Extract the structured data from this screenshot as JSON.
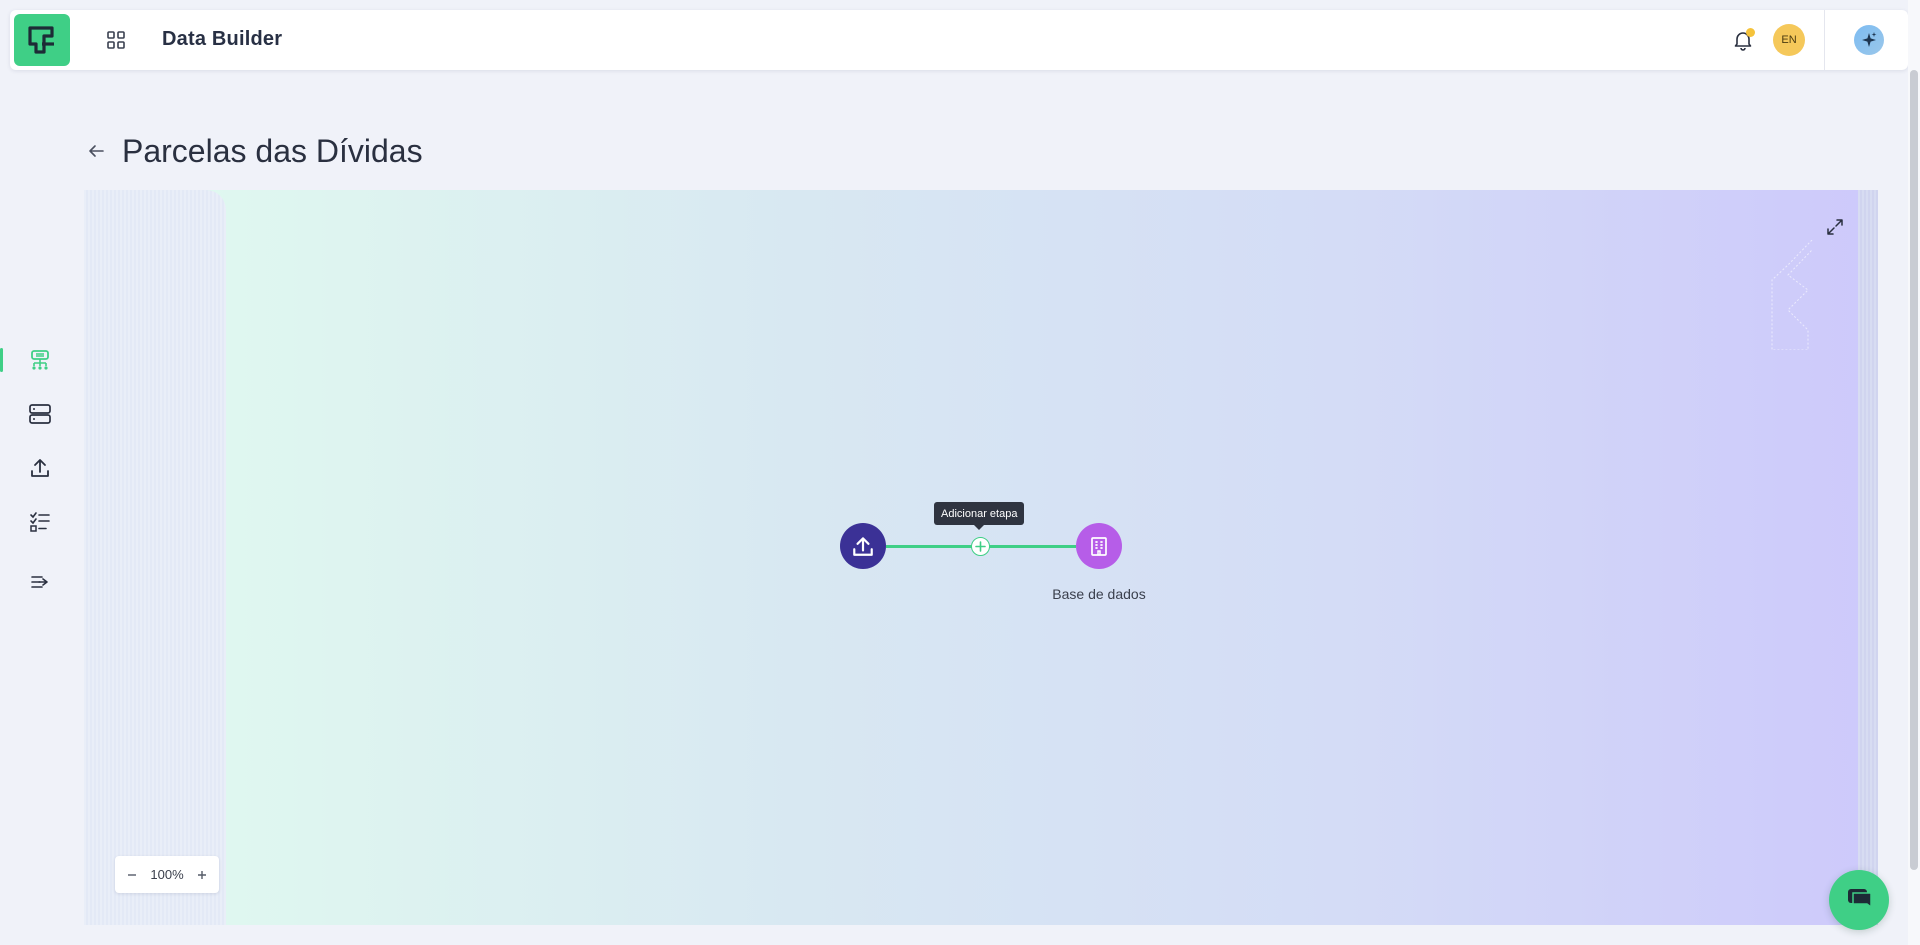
{
  "header": {
    "app_title": "Data Builder",
    "language": "EN",
    "icons": [
      "logo-icon",
      "apps-grid-icon",
      "bell-icon",
      "sparkle-icon"
    ]
  },
  "sidebar": {
    "items": [
      {
        "name": "pipeline",
        "icon": "pipeline-icon",
        "active": true
      },
      {
        "name": "databases",
        "icon": "server-icon",
        "active": false
      },
      {
        "name": "upload",
        "icon": "upload-icon",
        "active": false
      },
      {
        "name": "checklist",
        "icon": "checklist-icon",
        "active": false
      },
      {
        "name": "export",
        "icon": "export-list-icon",
        "active": false
      }
    ]
  },
  "page": {
    "title": "Parcelas das Dívidas"
  },
  "flow": {
    "tooltip": "Adicionar etapa",
    "target_node_label": "Base de dados",
    "zoom": "100%"
  },
  "colors": {
    "accent": "#3fcf86",
    "upload_node": "#3b3196",
    "db_node": "#b65de8",
    "lang_badge": "#f5c85a"
  }
}
